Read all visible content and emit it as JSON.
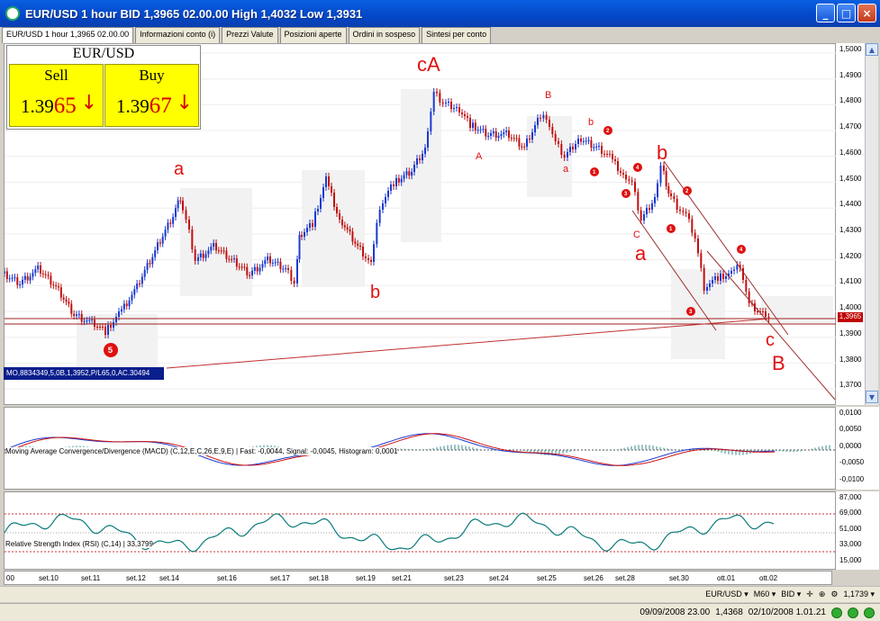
{
  "window": {
    "title": "EUR/USD 1 hour BID 1,3965 02.00.00 High 1,4032 Low 1,3931",
    "buttons": {
      "minimize": "_",
      "maximize": "□",
      "close": "×"
    }
  },
  "tabs": [
    {
      "label": "EUR/USD 1 hour 1,3965 02.00.00",
      "active": true
    },
    {
      "label": "Informazioni conto (i)"
    },
    {
      "label": "Prezzi Valute"
    },
    {
      "label": "Posizioni aperte"
    },
    {
      "label": "Ordini in sospeso"
    },
    {
      "label": "Sintesi per conto"
    }
  ],
  "quote": {
    "symbol": "EUR/USD",
    "sell_label": "Sell",
    "buy_label": "Buy",
    "sell_prefix": "1.39",
    "sell_suffix": "65",
    "buy_prefix": "1.39",
    "buy_suffix": "67",
    "arrow": "↓"
  },
  "price_axis": [
    "1,5000",
    "1,4900",
    "1,4800",
    "1,4700",
    "1,4600",
    "1,4500",
    "1,4400",
    "1,4300",
    "1,4200",
    "1,4100",
    "1,4000",
    "1,3900",
    "1,3800",
    "1,3700"
  ],
  "current_price": "1,3965",
  "ma_label": "MO,8834349,5,0B,1,3952,P/L65,0,AC.30494",
  "macd": {
    "label": "Moving Average Convergence/Divergence (MACD) (C,12,E,C,26,E,9,E) | Fast: -0,0044, Signal: -0,0045, Histogram: 0,0001",
    "axis": [
      "0,0100",
      "0,0050",
      "0,0000",
      "-0,0050",
      "-0,0100"
    ]
  },
  "rsi": {
    "label": "Relative Strength Index (RSI) (C,14) | 33,3799",
    "axis": [
      "87,000",
      "69,000",
      "51,000",
      "33,000",
      "15,000"
    ]
  },
  "x_axis": [
    "00",
    "set.10",
    "set.11",
    "set.12",
    "set.14",
    "set.16",
    "set.17",
    "set.18",
    "set.19",
    "set.21",
    "set.23",
    "set.24",
    "set.25",
    "set.26",
    "set.28",
    "set.30",
    "ott.01",
    "ott.02"
  ],
  "annotations": {
    "cA": "cA",
    "a1": "a",
    "b1": "b",
    "A": "A",
    "B_small": "B",
    "b_small": "b",
    "a_small": "a",
    "b_big": "b",
    "a_big": "a",
    "C_small": "C",
    "c_big": "c",
    "B_big": "B",
    "n1": "1",
    "n2": "2",
    "n3": "3",
    "n4": "4",
    "n5": "5"
  },
  "toolbar": {
    "instrument": "EUR/USD ▾",
    "period": "M60 ▾",
    "side": "BID ▾",
    "value": "1,1739 ▾"
  },
  "status": {
    "date_left": "09/09/2008 23.00",
    "value": "1,4368",
    "date_right": "02/10/2008 1.01.21"
  },
  "colors": {
    "title_bar": "#0347c8",
    "quote_box": "#ffff00",
    "up_candle": "#1a3ad0",
    "down_candle": "#c01010",
    "annotation": "#e01010",
    "macd_line": "#1a3ad0",
    "signal_line": "#d01010",
    "rsi_line": "#0a7a7a"
  }
}
